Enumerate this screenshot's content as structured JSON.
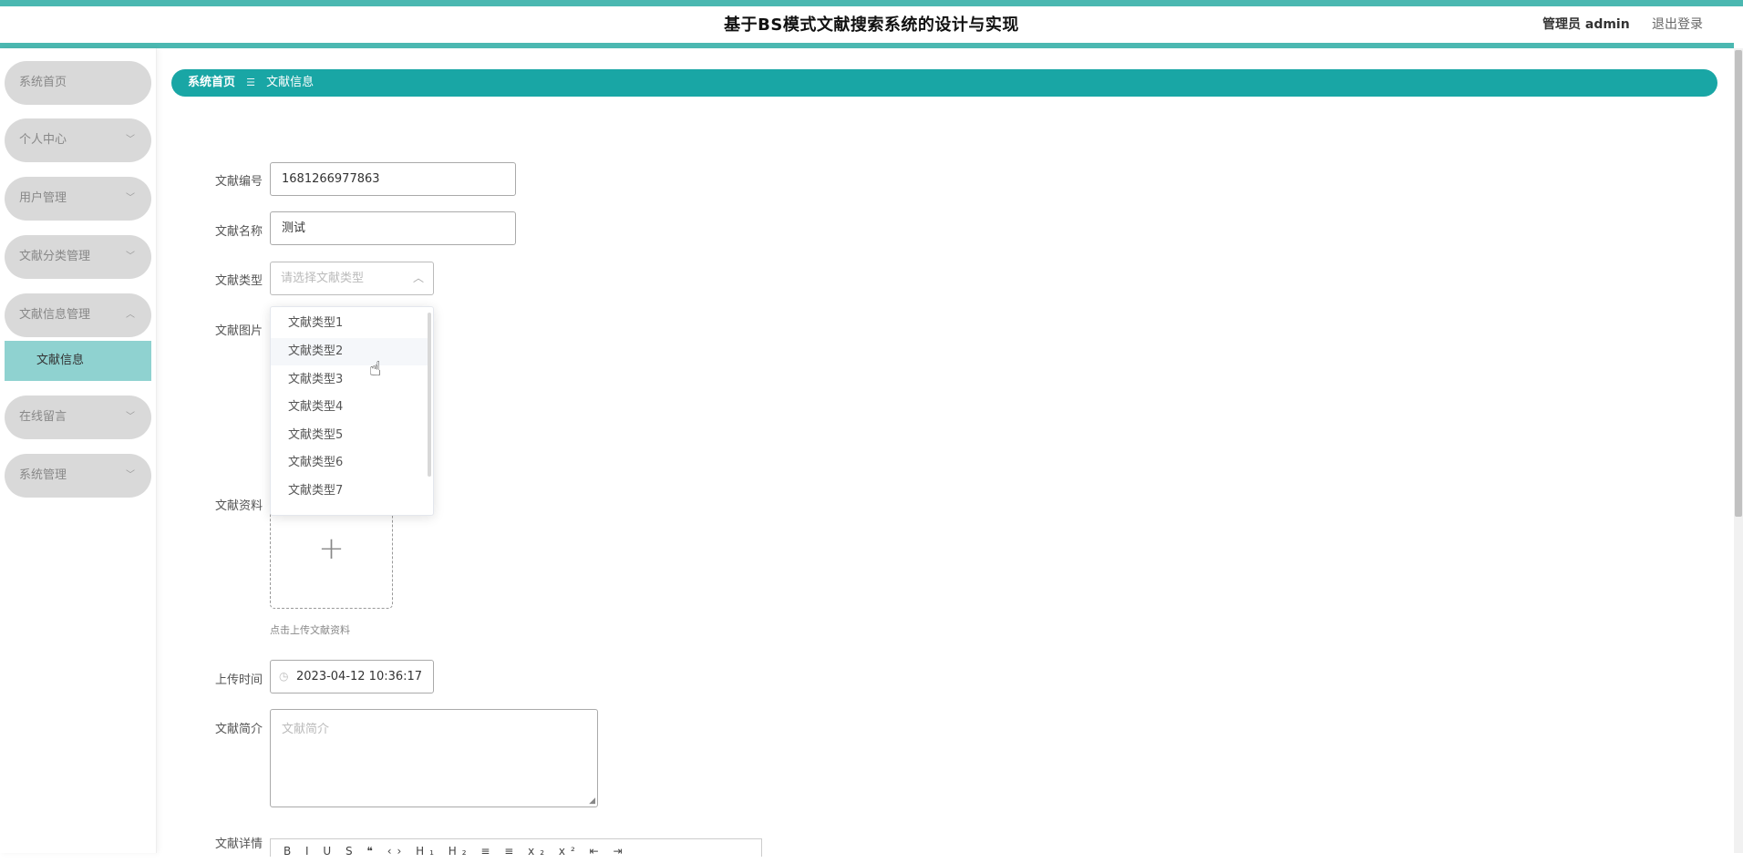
{
  "header": {
    "title": "基于BS模式文献搜索系统的设计与实现",
    "user_label": "管理员 admin",
    "logout_label": "退出登录"
  },
  "sidebar": {
    "items": [
      {
        "label": "系统首页"
      },
      {
        "label": "个人中心"
      },
      {
        "label": "用户管理"
      },
      {
        "label": "文献分类管理"
      },
      {
        "label": "文献信息管理"
      },
      {
        "label": "在线留言"
      },
      {
        "label": "系统管理"
      }
    ],
    "subitem": {
      "label": "文献信息"
    }
  },
  "breadcrumb": {
    "home": "系统首页",
    "separator": "☰",
    "current": "文献信息"
  },
  "form": {
    "number": {
      "label": "文献编号",
      "value": "1681266977863"
    },
    "name": {
      "label": "文献名称",
      "value": "测试"
    },
    "type": {
      "label": "文献类型",
      "placeholder": "请选择文献类型",
      "options": [
        "文献类型1",
        "文献类型2",
        "文献类型3",
        "文献类型4",
        "文献类型5",
        "文献类型6",
        "文献类型7"
      ],
      "hovered": "文献类型2"
    },
    "image": {
      "label": "文献图片"
    },
    "material": {
      "label": "文献资料",
      "upload_hint": "点击上传文献资料"
    },
    "upload_time": {
      "label": "上传时间",
      "value": "2023-04-12 10:36:17"
    },
    "summary": {
      "label": "文献简介",
      "placeholder": "文献简介"
    },
    "detail": {
      "label": "文献详情",
      "toolbar": "B I U S ❝ ‹› H₁ H₂ ≡ ≡ x₂ x² ⇤ ⇥"
    }
  },
  "colors": {
    "accent": "#19a6a5",
    "stripe": "#4bb8b1",
    "menu_bg": "#d9d9d9",
    "submenu_active": "#8fd2d0"
  }
}
